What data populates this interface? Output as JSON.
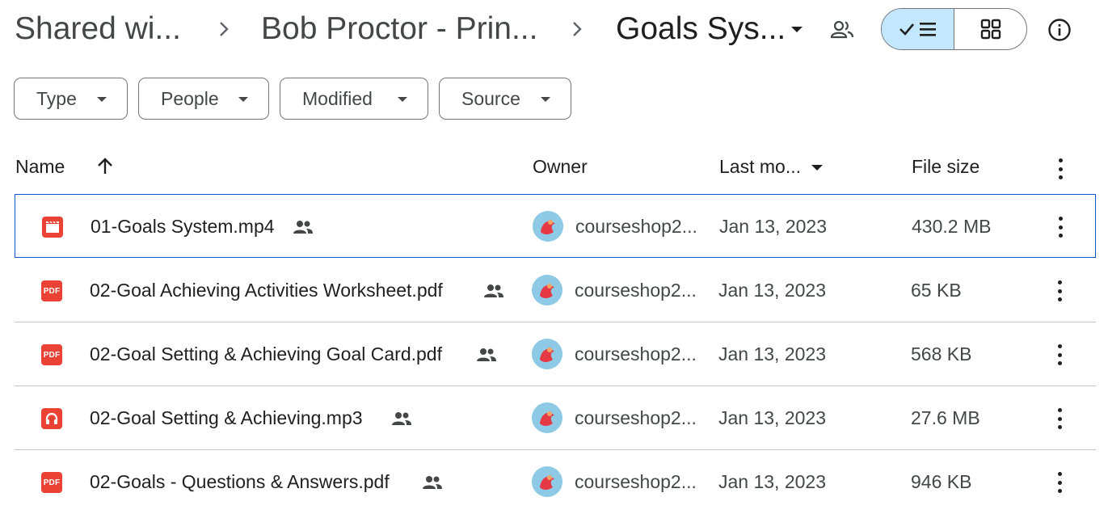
{
  "breadcrumb": {
    "items": [
      "Shared wi...",
      "Bob Proctor - Prin...",
      "Goals Sys..."
    ]
  },
  "icons": {
    "separator": "chevron-right-icon",
    "current_folder_menu": "caret-down-icon",
    "share": "people-icon",
    "list_view": "checkmark-list-icon",
    "grid_view": "grid-icon",
    "details": "info-icon",
    "sort": "arrow-up-icon",
    "more": "more-vert-icon",
    "shared_file": "people-icon",
    "video_file": "video-icon",
    "pdf_file": "pdf-icon",
    "audio_file": "headphones-icon"
  },
  "filters": [
    {
      "label": "Type"
    },
    {
      "label": "People"
    },
    {
      "label": "Modified"
    },
    {
      "label": "Source"
    }
  ],
  "columns": {
    "name": "Name",
    "owner": "Owner",
    "last_modified": "Last mo...",
    "file_size": "File size"
  },
  "files": [
    {
      "name": "01-Goals System.mp4",
      "type": "video",
      "owner": "courseshop2...",
      "modified": "Jan 13, 2023",
      "size": "430.2 MB",
      "selected": true
    },
    {
      "name": "02-Goal Achieving Activities Worksheet.pdf",
      "type": "pdf",
      "owner": "courseshop2...",
      "modified": "Jan 13, 2023",
      "size": "65 KB",
      "selected": false
    },
    {
      "name": "02-Goal Setting & Achieving Goal Card.pdf",
      "type": "pdf",
      "owner": "courseshop2...",
      "modified": "Jan 13, 2023",
      "size": "568 KB",
      "selected": false
    },
    {
      "name": "02-Goal Setting & Achieving.mp3",
      "type": "audio",
      "owner": "courseshop2...",
      "modified": "Jan 13, 2023",
      "size": "27.6 MB",
      "selected": false
    },
    {
      "name": "02-Goals - Questions & Answers.pdf",
      "type": "pdf",
      "owner": "courseshop2...",
      "modified": "Jan 13, 2023",
      "size": "946 KB",
      "selected": false
    }
  ],
  "colors": {
    "accent_selected": "#c2e7ff",
    "row_selected_border": "#0b57d0",
    "file_icon_red": "#ea4335"
  },
  "pdf_badge": "PDF"
}
